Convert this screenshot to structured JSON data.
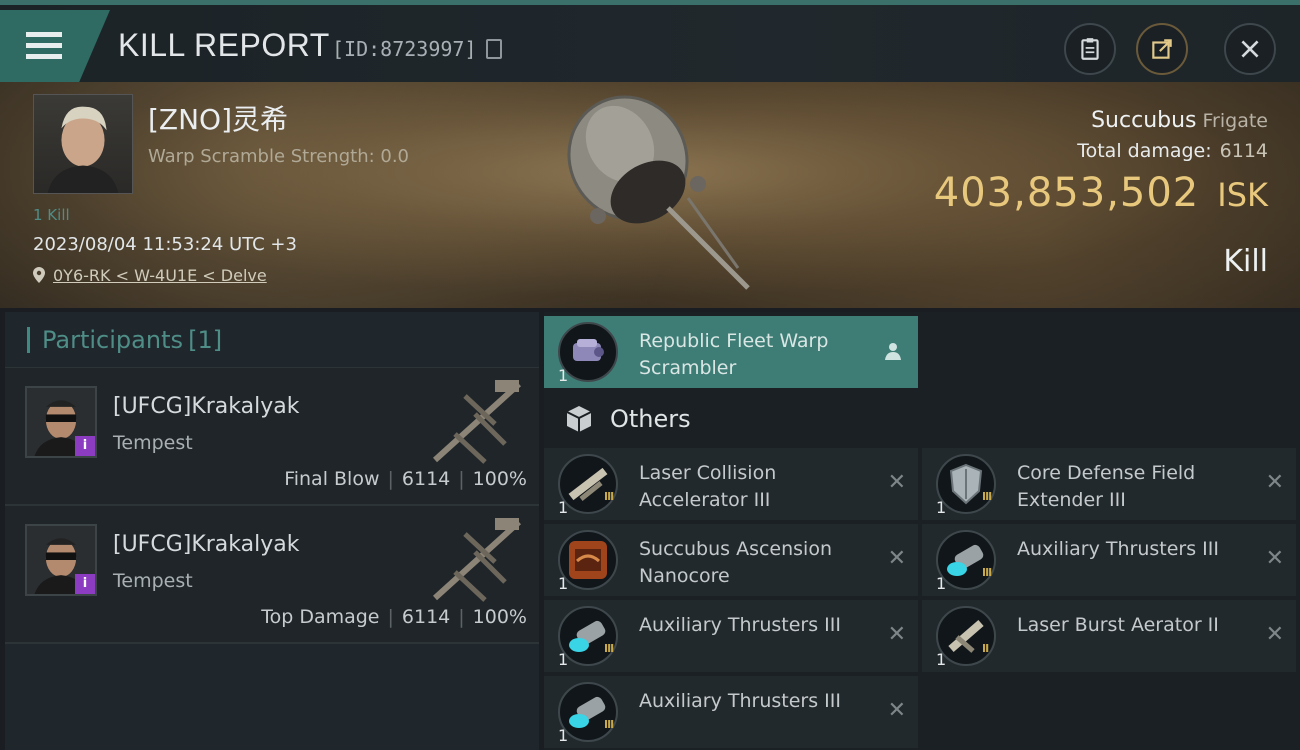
{
  "header": {
    "title": "KILL REPORT",
    "kill_id": "[ID:8723997]"
  },
  "victim": {
    "name": "[ZNO]灵希",
    "warp_scramble": "Warp Scramble Strength: 0.0",
    "kills": "1 Kill",
    "datetime": "2023/08/04 11:53:24 UTC +3",
    "location": "0Y6-RK < W-4U1E < Delve",
    "ship_name": "Succubus",
    "ship_class": "Frigate",
    "total_damage_label": "Total damage:",
    "total_damage": "6114",
    "isk_value": "403,853,502",
    "isk_unit": "ISK",
    "result": "Kill"
  },
  "participants": {
    "label": "Participants",
    "count": "[1]",
    "rows": [
      {
        "name": "[UFCG]Krakalyak",
        "ship": "Tempest",
        "role": "Final Blow",
        "damage": "6114",
        "percent": "100%"
      },
      {
        "name": "[UFCG]Krakalyak",
        "ship": "Tempest",
        "role": "Top Damage",
        "damage": "6114",
        "percent": "100%"
      }
    ]
  },
  "items": {
    "fitted": {
      "name": "Republic Fleet Warp Scrambler",
      "qty": "1"
    },
    "others_label": "Others",
    "list": [
      {
        "name": "Laser Collision Accelerator III",
        "qty": "1",
        "tier": "III"
      },
      {
        "name": "Core Defense Field Extender III",
        "qty": "1",
        "tier": "III"
      },
      {
        "name": "Succubus Ascension Nanocore",
        "qty": "1",
        "tier": ""
      },
      {
        "name": "Auxiliary Thrusters III",
        "qty": "1",
        "tier": "III"
      },
      {
        "name": "Auxiliary Thrusters III",
        "qty": "1",
        "tier": "III"
      },
      {
        "name": "Laser Burst Aerator II",
        "qty": "1",
        "tier": "II"
      },
      {
        "name": "Auxiliary Thrusters III",
        "qty": "1",
        "tier": "III"
      }
    ],
    "remove_glyph": "✕"
  },
  "colors": {
    "accent": "#3e7d76",
    "isk": "#e8c87c",
    "badge": "#8c3cc0"
  },
  "icons": [
    "menu-icon",
    "copy-icon",
    "clipboard-icon",
    "share-icon",
    "close-icon",
    "pin-icon",
    "cube-icon",
    "person-icon"
  ]
}
